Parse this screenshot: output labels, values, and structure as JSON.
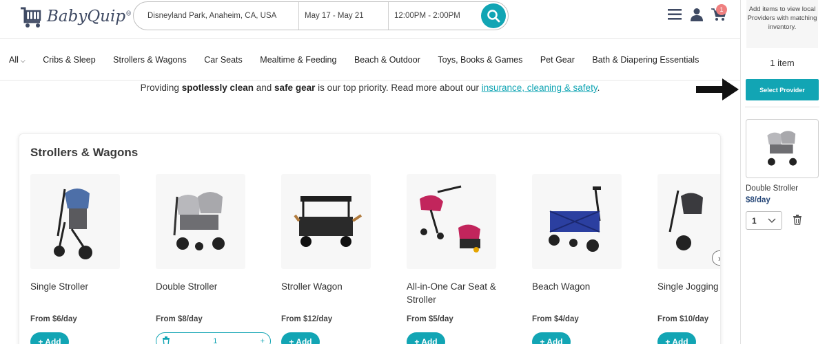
{
  "header": {
    "logo_text": "BabyQuip",
    "logo_reg": "®",
    "location": "Disneyland Park, Anaheim, CA, USA",
    "dates": "May 17 - May 21",
    "time": "12:00PM - 2:00PM",
    "cart_count": "1",
    "icons": [
      "menu-icon",
      "user-icon",
      "cart-icon",
      "search-icon"
    ]
  },
  "nav": {
    "all_label": "All",
    "categories": [
      "Cribs & Sleep",
      "Strollers & Wagons",
      "Car Seats",
      "Mealtime & Feeding",
      "Beach & Outdoor",
      "Toys, Books & Games",
      "Pet Gear",
      "Bath & Diapering Essentials"
    ]
  },
  "notice": {
    "pre": "Providing ",
    "b1": "spotlessly clean",
    "mid": " and ",
    "b2": "safe gear",
    "post": " is our top priority. Read more about our ",
    "link": "insurance, cleaning & safety",
    "end": "."
  },
  "section": {
    "title": "Strollers & Wagons",
    "products": [
      {
        "name": "Single Stroller",
        "price": "From $6/day",
        "add": "+ Add"
      },
      {
        "name": "Double Stroller",
        "price": "From $8/day",
        "qty": "1",
        "plus": "+"
      },
      {
        "name": "Stroller Wagon",
        "price": "From $12/day",
        "add": "+ Add"
      },
      {
        "name": "All-in-One Car Seat & Stroller",
        "price": "From $5/day",
        "add": "+ Add"
      },
      {
        "name": "Beach Wagon",
        "price": "From $4/day",
        "add": "+ Add"
      },
      {
        "name": "Single Jogging Stroller",
        "price": "From $10/day",
        "add": "+ Add"
      }
    ]
  },
  "sidebar": {
    "hint": "Add items to view local Providers with matching inventory.",
    "count": "1 item",
    "select_label": "Select Provider",
    "item_name": "Double Stroller",
    "item_price": "$8/day",
    "item_qty": "1"
  },
  "colors": {
    "accent": "#12a5b4",
    "badge": "#ef8080",
    "price_blue": "#2a4a7a"
  }
}
